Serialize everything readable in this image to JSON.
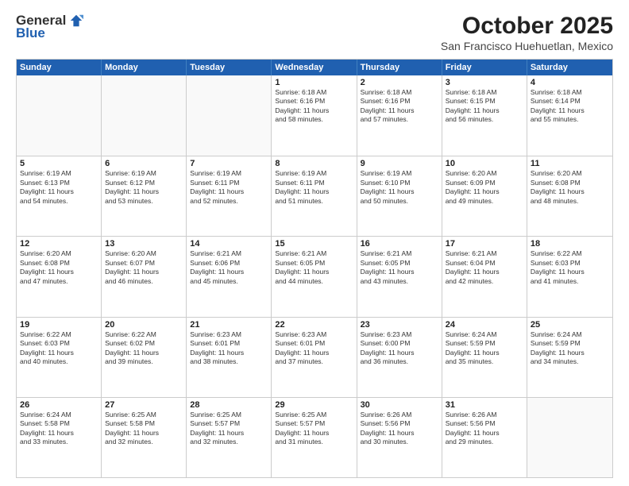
{
  "logo": {
    "general": "General",
    "blue": "Blue"
  },
  "header": {
    "month": "October 2025",
    "location": "San Francisco Huehuetlan, Mexico"
  },
  "weekdays": [
    "Sunday",
    "Monday",
    "Tuesday",
    "Wednesday",
    "Thursday",
    "Friday",
    "Saturday"
  ],
  "weeks": [
    [
      {
        "day": "",
        "info": "",
        "empty": true
      },
      {
        "day": "",
        "info": "",
        "empty": true
      },
      {
        "day": "",
        "info": "",
        "empty": true
      },
      {
        "day": "1",
        "info": "Sunrise: 6:18 AM\nSunset: 6:16 PM\nDaylight: 11 hours\nand 58 minutes."
      },
      {
        "day": "2",
        "info": "Sunrise: 6:18 AM\nSunset: 6:16 PM\nDaylight: 11 hours\nand 57 minutes."
      },
      {
        "day": "3",
        "info": "Sunrise: 6:18 AM\nSunset: 6:15 PM\nDaylight: 11 hours\nand 56 minutes."
      },
      {
        "day": "4",
        "info": "Sunrise: 6:18 AM\nSunset: 6:14 PM\nDaylight: 11 hours\nand 55 minutes."
      }
    ],
    [
      {
        "day": "5",
        "info": "Sunrise: 6:19 AM\nSunset: 6:13 PM\nDaylight: 11 hours\nand 54 minutes."
      },
      {
        "day": "6",
        "info": "Sunrise: 6:19 AM\nSunset: 6:12 PM\nDaylight: 11 hours\nand 53 minutes."
      },
      {
        "day": "7",
        "info": "Sunrise: 6:19 AM\nSunset: 6:11 PM\nDaylight: 11 hours\nand 52 minutes."
      },
      {
        "day": "8",
        "info": "Sunrise: 6:19 AM\nSunset: 6:11 PM\nDaylight: 11 hours\nand 51 minutes."
      },
      {
        "day": "9",
        "info": "Sunrise: 6:19 AM\nSunset: 6:10 PM\nDaylight: 11 hours\nand 50 minutes."
      },
      {
        "day": "10",
        "info": "Sunrise: 6:20 AM\nSunset: 6:09 PM\nDaylight: 11 hours\nand 49 minutes."
      },
      {
        "day": "11",
        "info": "Sunrise: 6:20 AM\nSunset: 6:08 PM\nDaylight: 11 hours\nand 48 minutes."
      }
    ],
    [
      {
        "day": "12",
        "info": "Sunrise: 6:20 AM\nSunset: 6:08 PM\nDaylight: 11 hours\nand 47 minutes."
      },
      {
        "day": "13",
        "info": "Sunrise: 6:20 AM\nSunset: 6:07 PM\nDaylight: 11 hours\nand 46 minutes."
      },
      {
        "day": "14",
        "info": "Sunrise: 6:21 AM\nSunset: 6:06 PM\nDaylight: 11 hours\nand 45 minutes."
      },
      {
        "day": "15",
        "info": "Sunrise: 6:21 AM\nSunset: 6:05 PM\nDaylight: 11 hours\nand 44 minutes."
      },
      {
        "day": "16",
        "info": "Sunrise: 6:21 AM\nSunset: 6:05 PM\nDaylight: 11 hours\nand 43 minutes."
      },
      {
        "day": "17",
        "info": "Sunrise: 6:21 AM\nSunset: 6:04 PM\nDaylight: 11 hours\nand 42 minutes."
      },
      {
        "day": "18",
        "info": "Sunrise: 6:22 AM\nSunset: 6:03 PM\nDaylight: 11 hours\nand 41 minutes."
      }
    ],
    [
      {
        "day": "19",
        "info": "Sunrise: 6:22 AM\nSunset: 6:03 PM\nDaylight: 11 hours\nand 40 minutes."
      },
      {
        "day": "20",
        "info": "Sunrise: 6:22 AM\nSunset: 6:02 PM\nDaylight: 11 hours\nand 39 minutes."
      },
      {
        "day": "21",
        "info": "Sunrise: 6:23 AM\nSunset: 6:01 PM\nDaylight: 11 hours\nand 38 minutes."
      },
      {
        "day": "22",
        "info": "Sunrise: 6:23 AM\nSunset: 6:01 PM\nDaylight: 11 hours\nand 37 minutes."
      },
      {
        "day": "23",
        "info": "Sunrise: 6:23 AM\nSunset: 6:00 PM\nDaylight: 11 hours\nand 36 minutes."
      },
      {
        "day": "24",
        "info": "Sunrise: 6:24 AM\nSunset: 5:59 PM\nDaylight: 11 hours\nand 35 minutes."
      },
      {
        "day": "25",
        "info": "Sunrise: 6:24 AM\nSunset: 5:59 PM\nDaylight: 11 hours\nand 34 minutes."
      }
    ],
    [
      {
        "day": "26",
        "info": "Sunrise: 6:24 AM\nSunset: 5:58 PM\nDaylight: 11 hours\nand 33 minutes."
      },
      {
        "day": "27",
        "info": "Sunrise: 6:25 AM\nSunset: 5:58 PM\nDaylight: 11 hours\nand 32 minutes."
      },
      {
        "day": "28",
        "info": "Sunrise: 6:25 AM\nSunset: 5:57 PM\nDaylight: 11 hours\nand 32 minutes."
      },
      {
        "day": "29",
        "info": "Sunrise: 6:25 AM\nSunset: 5:57 PM\nDaylight: 11 hours\nand 31 minutes."
      },
      {
        "day": "30",
        "info": "Sunrise: 6:26 AM\nSunset: 5:56 PM\nDaylight: 11 hours\nand 30 minutes."
      },
      {
        "day": "31",
        "info": "Sunrise: 6:26 AM\nSunset: 5:56 PM\nDaylight: 11 hours\nand 29 minutes."
      },
      {
        "day": "",
        "info": "",
        "empty": true
      }
    ]
  ]
}
